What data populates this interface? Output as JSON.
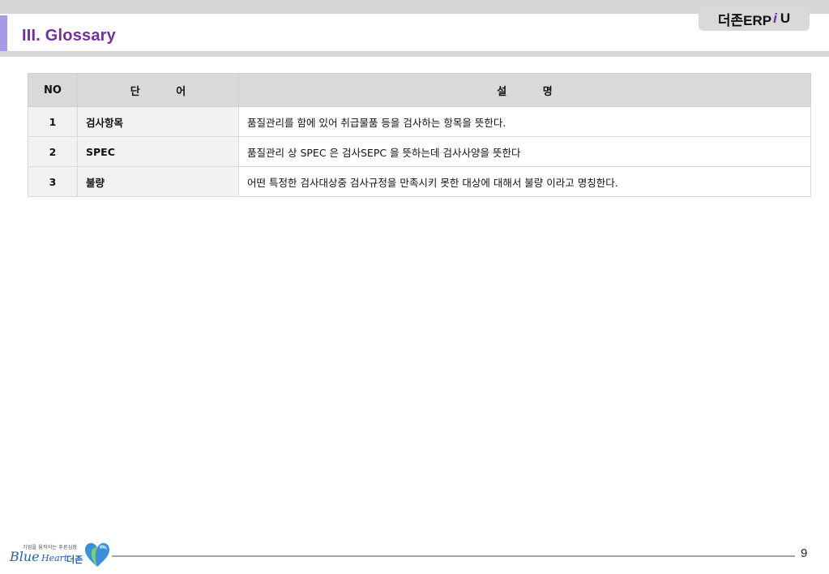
{
  "header": {
    "brand_prefix": "더존ERP",
    "brand_i": "i",
    "brand_suffix": "U",
    "title": "III. Glossary"
  },
  "table": {
    "columns": [
      "NO",
      "단 어",
      "설 명"
    ],
    "rows": [
      {
        "no": "1",
        "term": "검사항목",
        "desc": "품질관리를 함에 있어 취급물품 등을 검사하는 항목을 뜻한다."
      },
      {
        "no": "2",
        "term": "SPEC",
        "desc": "품질관리 상 SPEC 은 검사SEPC 을 뜻하는데 검사사양을 뜻한다"
      },
      {
        "no": "3",
        "term": "불량",
        "desc": "어떤 특정한 검사대상중 검사규정을 만족시키 못한 대상에 대해서 불량 이라고 명칭한다."
      }
    ]
  },
  "footer": {
    "logo_tagline": "기업을 움직이는 푸른심장",
    "logo_word_blue": "Blue",
    "logo_word_heart": "Heart",
    "logo_korean": "더존",
    "page_number": "9"
  },
  "colors": {
    "title": "#7030a0",
    "accent_bar": "#a79ae6",
    "header_band": "#d6d6d6",
    "table_header": "#d9d9d9",
    "logo_blue": "#2a5db0"
  },
  "icons": [
    "heart-logo-icon"
  ]
}
